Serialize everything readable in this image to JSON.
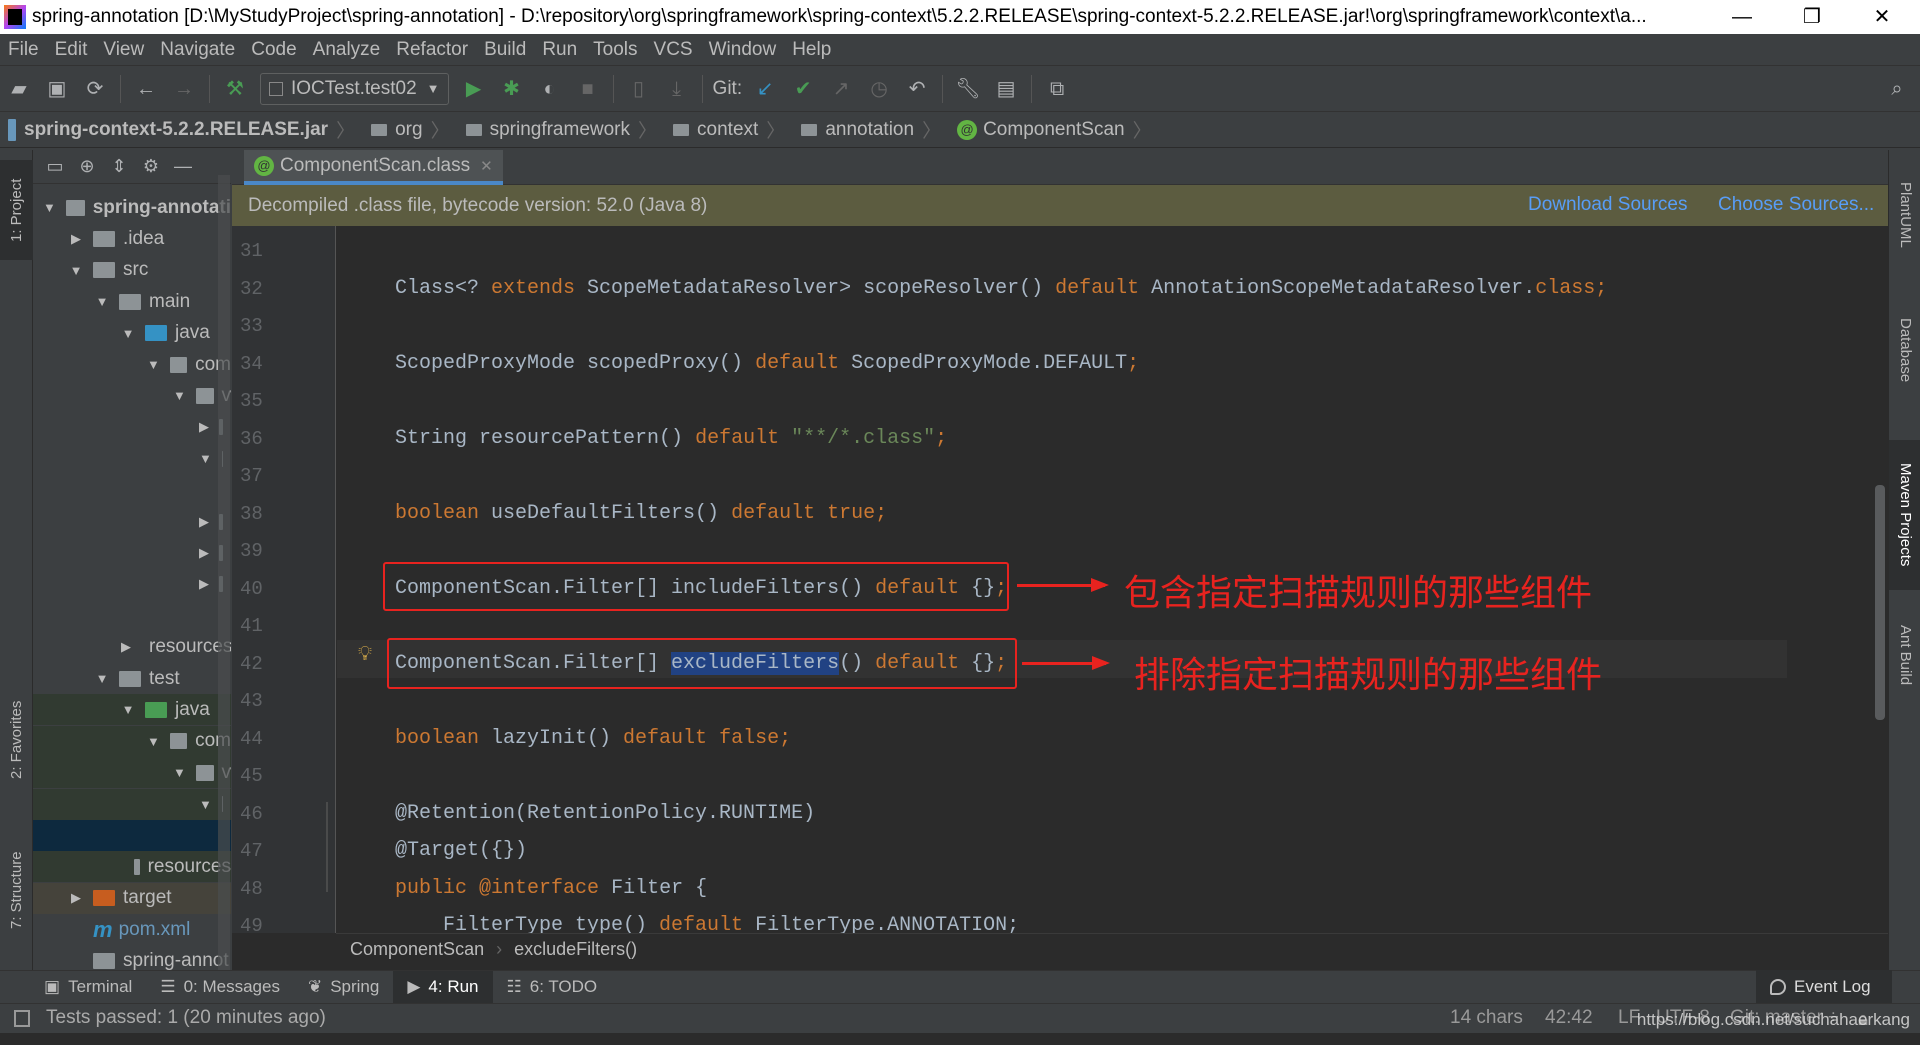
{
  "window": {
    "title": "spring-annotation [D:\\MyStudyProject\\spring-annotation] - D:\\repository\\org\\springframework\\spring-context\\5.2.2.RELEASE\\spring-context-5.2.2.RELEASE.jar!\\org\\springframework\\context\\a...",
    "minimize": "—",
    "restore": "❐",
    "close": "✕"
  },
  "menu": [
    "File",
    "Edit",
    "View",
    "Navigate",
    "Code",
    "Analyze",
    "Refactor",
    "Build",
    "Run",
    "Tools",
    "VCS",
    "Window",
    "Help"
  ],
  "toolbar": {
    "run_config": "IOCTest.test02",
    "git_label": "Git:"
  },
  "breadcrumb": [
    "spring-context-5.2.2.RELEASE.jar",
    "org",
    "springframework",
    "context",
    "annotation",
    "ComponentScan"
  ],
  "left_strip": {
    "project": "1: Project",
    "favorites": "2: Favorites",
    "structure": "7: Structure"
  },
  "right_strip": [
    "PlantUML",
    "Database",
    "Maven Projects",
    "Ant Build"
  ],
  "project_tree": [
    {
      "label": "spring-annotati",
      "level": 0,
      "arrow": "down",
      "icon": "module"
    },
    {
      "label": ".idea",
      "level": 1,
      "arrow": "right",
      "icon": "folder"
    },
    {
      "label": "src",
      "level": 1,
      "arrow": "down",
      "icon": "folder"
    },
    {
      "label": "main",
      "level": 2,
      "arrow": "down",
      "icon": "folder"
    },
    {
      "label": "java",
      "level": 3,
      "arrow": "down",
      "icon": "source-folder"
    },
    {
      "label": "com",
      "level": 4,
      "arrow": "down",
      "icon": "package"
    },
    {
      "label": "v",
      "level": 5,
      "arrow": "down",
      "icon": "package"
    },
    {
      "label": "",
      "level": 6,
      "arrow": "right",
      "icon": "package"
    },
    {
      "label": "",
      "level": 6,
      "arrow": "down",
      "icon": "package"
    },
    {
      "label": "",
      "level": 7,
      "arrow": "",
      "icon": ""
    },
    {
      "label": "",
      "level": 6,
      "arrow": "right",
      "icon": "package"
    },
    {
      "label": "",
      "level": 6,
      "arrow": "right",
      "icon": "package"
    },
    {
      "label": "",
      "level": 6,
      "arrow": "right",
      "icon": "package"
    },
    {
      "label": "",
      "level": 7,
      "arrow": "",
      "icon": "class"
    },
    {
      "label": "resources",
      "level": 3,
      "arrow": "right",
      "icon": "resources"
    },
    {
      "label": "test",
      "level": 2,
      "arrow": "down",
      "icon": "folder"
    },
    {
      "label": "java",
      "level": 3,
      "arrow": "down",
      "icon": "test-folder"
    },
    {
      "label": "com",
      "level": 4,
      "arrow": "down",
      "icon": "package"
    },
    {
      "label": "v",
      "level": 5,
      "arrow": "down",
      "icon": "package"
    },
    {
      "label": "",
      "level": 6,
      "arrow": "down",
      "icon": "package"
    },
    {
      "label": "",
      "level": 7,
      "arrow": "",
      "icon": "",
      "selected": true
    },
    {
      "label": "resources",
      "level": 3,
      "arrow": "",
      "icon": "test-resources"
    },
    {
      "label": "target",
      "level": 1,
      "arrow": "right",
      "icon": "excluded-folder"
    },
    {
      "label": "pom.xml",
      "level": 1,
      "arrow": "",
      "icon": "maven"
    },
    {
      "label": "spring-annot",
      "level": 1,
      "arrow": "",
      "icon": "module"
    }
  ],
  "editor": {
    "tab": "ComponentScan.class",
    "banner": "Decompiled .class file, bytecode version: 52.0 (Java 8)",
    "download_sources": "Download Sources",
    "choose_sources": "Choose Sources...",
    "lines": [
      {
        "n": "31",
        "tokens": []
      },
      {
        "n": "32",
        "tokens": [
          [
            "t",
            "Class<? "
          ],
          [
            "kw",
            "extends"
          ],
          [
            "t",
            " ScopeMetadataResolver> scopeResolver() "
          ],
          [
            "kw",
            "default"
          ],
          [
            "t",
            " AnnotationScopeMetadataResolver."
          ],
          [
            "kw",
            "class"
          ],
          [
            "kw",
            ";"
          ]
        ]
      },
      {
        "n": "33",
        "tokens": []
      },
      {
        "n": "34",
        "tokens": [
          [
            "t",
            "ScopedProxyMode scopedProxy() "
          ],
          [
            "kw",
            "default"
          ],
          [
            "t",
            " ScopedProxyMode.DEFAULT"
          ],
          [
            "kw",
            ";"
          ]
        ]
      },
      {
        "n": "35",
        "tokens": []
      },
      {
        "n": "36",
        "tokens": [
          [
            "t",
            "String resourcePattern() "
          ],
          [
            "kw",
            "default"
          ],
          [
            "t",
            " "
          ],
          [
            "str",
            "\"**/*.class\""
          ],
          [
            "kw",
            ";"
          ]
        ]
      },
      {
        "n": "37",
        "tokens": []
      },
      {
        "n": "38",
        "tokens": [
          [
            "kw",
            "boolean"
          ],
          [
            "t",
            " useDefaultFilters() "
          ],
          [
            "kw",
            "default"
          ],
          [
            "t",
            " "
          ],
          [
            "kw",
            "true;"
          ]
        ]
      },
      {
        "n": "39",
        "tokens": []
      },
      {
        "n": "40",
        "tokens": [
          [
            "t",
            "ComponentScan.Filter[] includeFilters() "
          ],
          [
            "kw",
            "default"
          ],
          [
            "t",
            " {}"
          ],
          [
            "kw",
            ";"
          ]
        ]
      },
      {
        "n": "41",
        "tokens": []
      },
      {
        "n": "42",
        "tokens": [
          [
            "t",
            "ComponentScan.Filter[] "
          ],
          [
            "sel",
            "excludeFilters"
          ],
          [
            "t",
            "() "
          ],
          [
            "kw",
            "default"
          ],
          [
            "t",
            " {}"
          ],
          [
            "kw",
            ";"
          ]
        ]
      },
      {
        "n": "43",
        "tokens": []
      },
      {
        "n": "44",
        "tokens": [
          [
            "kw",
            "boolean"
          ],
          [
            "t",
            " lazyInit() "
          ],
          [
            "kw",
            "default"
          ],
          [
            "t",
            " "
          ],
          [
            "kw",
            "false;"
          ]
        ]
      },
      {
        "n": "45",
        "tokens": []
      },
      {
        "n": "46",
        "tokens": [
          [
            "t",
            "@Retention(RetentionPolicy.RUNTIME)"
          ]
        ]
      },
      {
        "n": "47",
        "tokens": [
          [
            "t",
            "@Target({})"
          ]
        ]
      },
      {
        "n": "48",
        "tokens": [
          [
            "kw",
            "public"
          ],
          [
            "t",
            " "
          ],
          [
            "kw",
            "@interface"
          ],
          [
            "t",
            " Filter {"
          ]
        ]
      },
      {
        "n": "49",
        "tokens": [
          [
            "t",
            "    FilterType type() "
          ],
          [
            "kw",
            "default"
          ],
          [
            "t",
            " FilterType.ANNOTATION;"
          ]
        ]
      }
    ],
    "annotations": {
      "include": "包含指定扫描规则的那些组件",
      "exclude": "排除指定扫描规则的那些组件"
    },
    "breadcrumb": [
      "ComponentScan",
      "excludeFilters()"
    ]
  },
  "bottom_tabs": [
    {
      "label": "Terminal",
      "icon": "terminal-icon"
    },
    {
      "label": "0: Messages",
      "icon": "messages-icon"
    },
    {
      "label": "Spring",
      "icon": "spring-icon"
    },
    {
      "label": "4: Run",
      "icon": "run-icon",
      "active": true
    },
    {
      "label": "6: TODO",
      "icon": "todo-icon"
    }
  ],
  "event_log": "Event Log",
  "status": {
    "message": "Tests passed: 1 (20 minutes ago)",
    "chars": "14 chars",
    "position": "42:42",
    "line_sep": "LF",
    "encoding": "UTF-8",
    "git": "Git: master ÷"
  },
  "watermark": "https://blog.csdn.net/suchahaerkang",
  "colors": {
    "keyword": "#cc7832",
    "string": "#6a8759",
    "text": "#a9b7c6",
    "selection": "#214283",
    "annotation_red": "#e8231f",
    "link": "#589df6",
    "banner": "#5c5c40"
  }
}
